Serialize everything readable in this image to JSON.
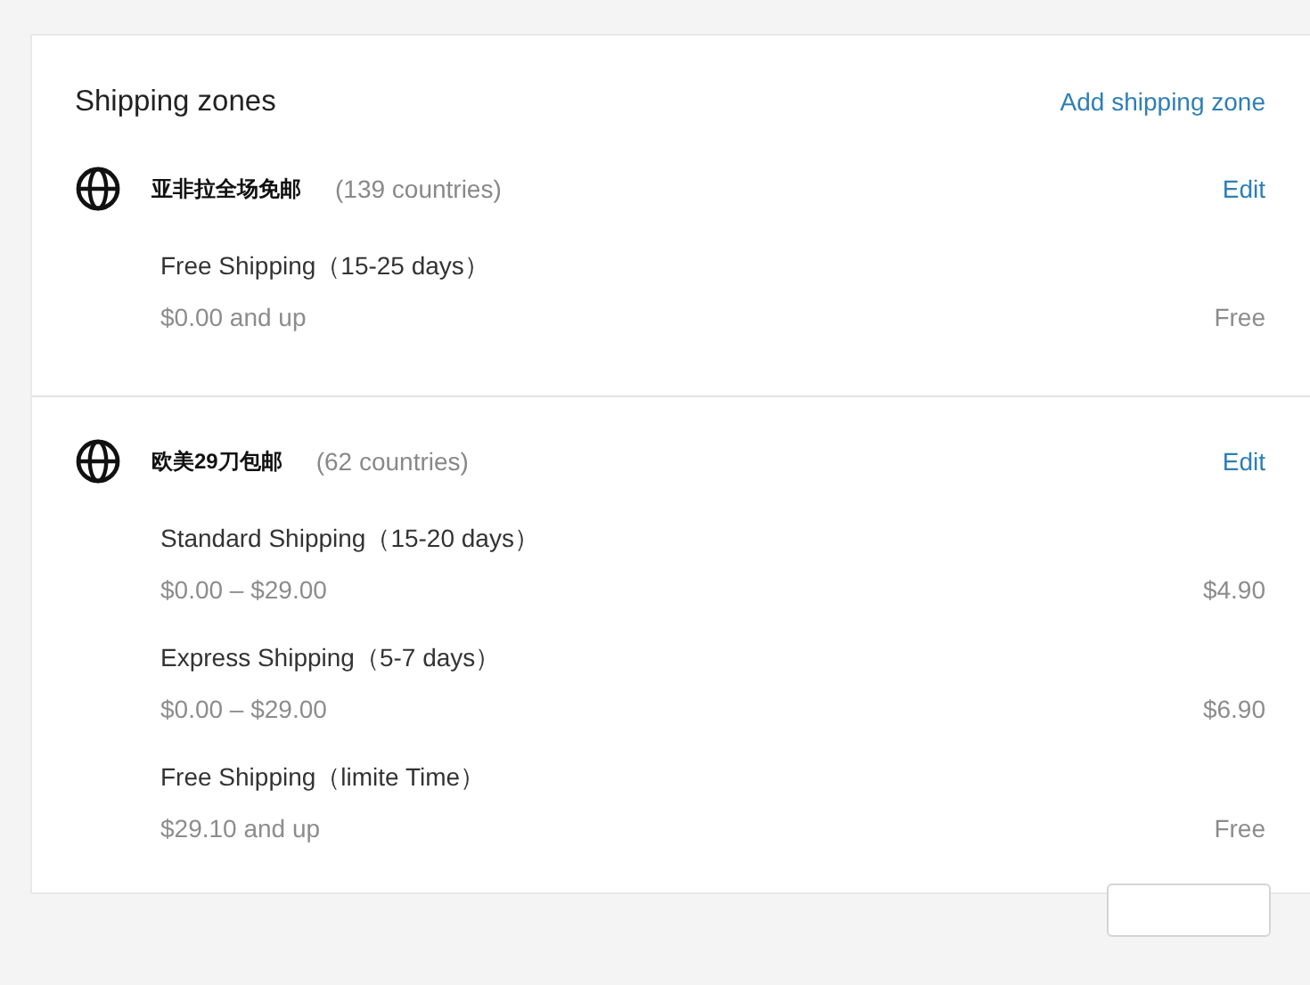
{
  "card": {
    "title": "Shipping zones",
    "add_link": "Add shipping zone"
  },
  "zones": [
    {
      "name": "亚非拉全场免邮",
      "countries": "(139 countries)",
      "edit": "Edit",
      "rates": [
        {
          "name": "Free Shipping（15-25 days）",
          "range": "$0.00 and up",
          "price": "Free"
        }
      ]
    },
    {
      "name": "欧美29刀包邮",
      "countries": "(62 countries)",
      "edit": "Edit",
      "rates": [
        {
          "name": "Standard Shipping（15-20 days）",
          "range": "$0.00 – $29.00",
          "price": "$4.90"
        },
        {
          "name": "Express Shipping（5-7 days）",
          "range": "$0.00 – $29.00",
          "price": "$6.90"
        },
        {
          "name": "Free Shipping（limite Time）",
          "range": "$29.10 and up",
          "price": "Free"
        }
      ]
    }
  ]
}
